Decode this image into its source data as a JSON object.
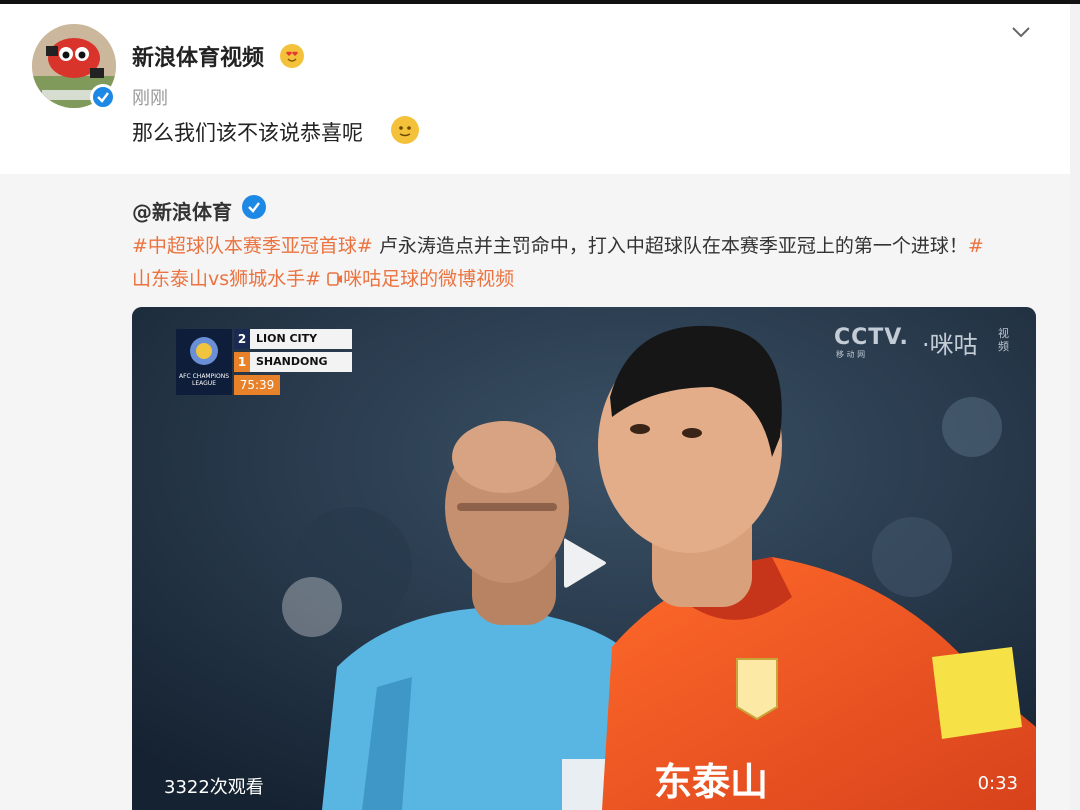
{
  "post": {
    "username": "新浪体育视频",
    "avatar_icon": "sina-sports-avatar",
    "time": "刚刚",
    "text": "那么我们该不该说恭喜呢",
    "text_emoji": "smile-emoji",
    "badge_emoji": "heart-eyes-emoji"
  },
  "repost": {
    "username": "@新浪体育",
    "line1_tag": "#中超球队本赛季亚冠首球#",
    "line1_text": " 卢永涛造点并主罚命中，打入中超球队在本赛季亚冠上的第一个进球！",
    "line1_tail": "#",
    "line2_tag": "山东泰山vs狮城水手#",
    "line2_link": "咪咕足球的微博视频",
    "link_icon": "video-link-icon"
  },
  "video": {
    "scoreboard": {
      "team1_score": "2",
      "team1_name": "LION CITY",
      "team2_score": "1",
      "team2_name": "SHANDONG",
      "clock": "75:39",
      "league_text": "AFC CHAMPIONS LEAGUE"
    },
    "watermark_cctv": "CCTV.",
    "watermark_cctv_sub": "移 动 网",
    "watermark_migu": "·咪咕",
    "watermark_migu_sub": "视频",
    "jersey_text": "东泰山",
    "views": "3322次观看",
    "duration": "0:33"
  },
  "colors": {
    "tag": "#eb7340",
    "verified": "#1e88e5",
    "clock_bg": "#e8822a"
  }
}
